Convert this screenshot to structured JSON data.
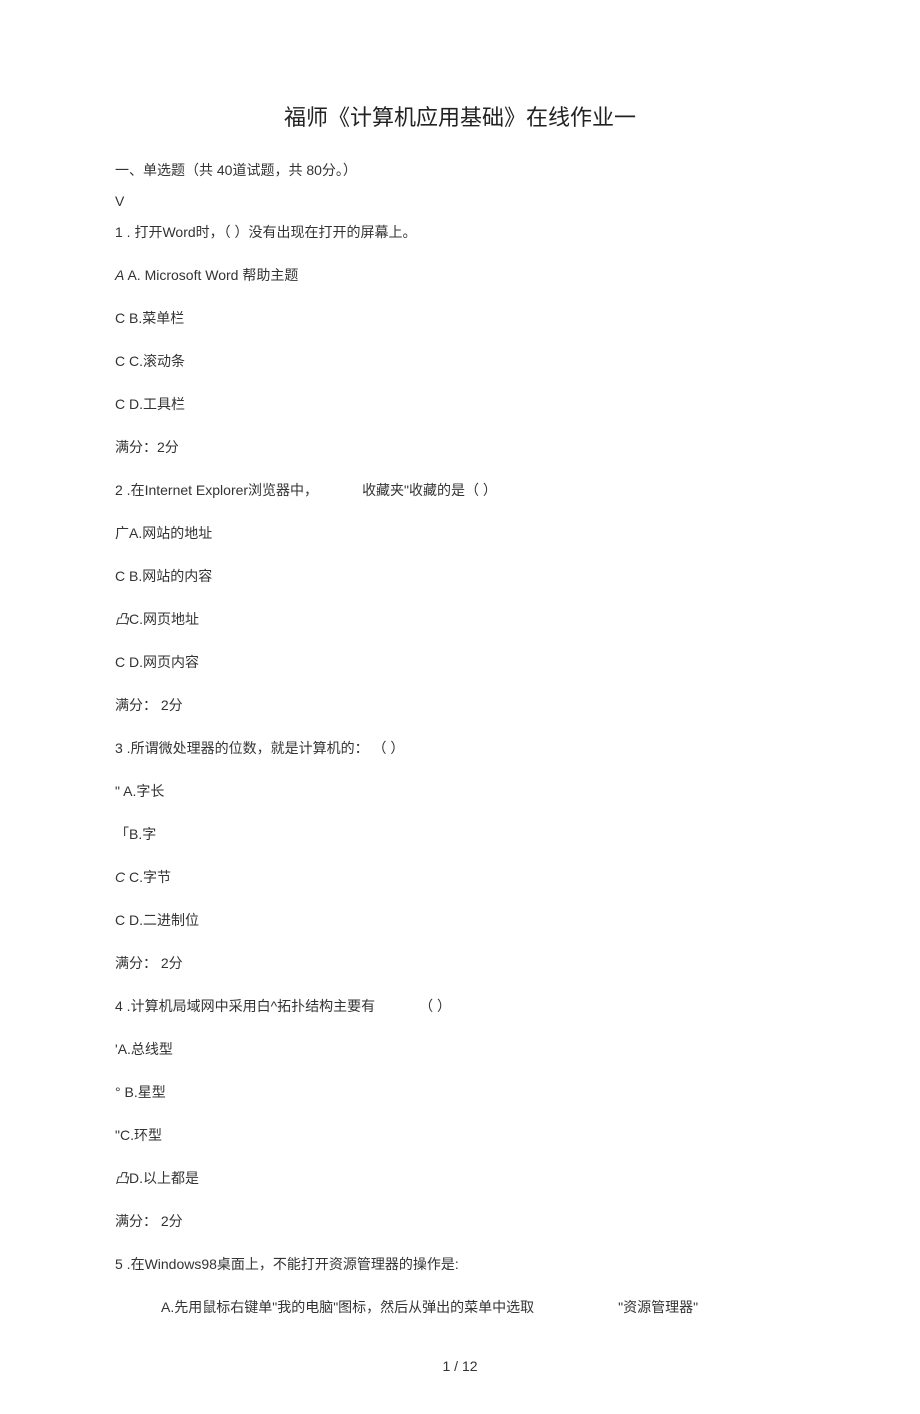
{
  "title": "福师《计算机应用基础》在线作业一",
  "section_header": "一、单选题（共 40道试题，共 80分。）",
  "v": "V",
  "q1": {
    "stem": "1 . 打开Word时，（ ）没有出现在打开的屏幕上。",
    "A_prefix": "A",
    "A": "A. Microsoft Word 帮助主题",
    "B_prefix": "C",
    "B": "B.菜单栏",
    "C_prefix": "C",
    "C": "C.滚动条",
    "D_prefix": "C",
    "D": "D.工具栏",
    "score": "满分：2分"
  },
  "q2": {
    "stem_a": "2  .在Internet Explorer浏览器中，",
    "stem_b": "收藏夹\"收藏的是（ ）",
    "A_prefix": "广",
    "A": "A.网站的地址",
    "B_prefix": "C",
    "B": "B.网站的内容",
    "C_prefix": "凸",
    "C": "C.网页地址",
    "D_prefix": "C",
    "D": "D.网页内容",
    "score": "满分： 2分"
  },
  "q3": {
    "stem": "3  .所谓微处理器的位数，就是计算机的：  （ ）",
    "A_prefix": "\"",
    "A": "A.字长",
    "B_prefix": "「",
    "B": "B.字",
    "C_prefix": "C",
    "C_italic": true,
    "C": "C.字节",
    "D_prefix": "C",
    "D": "D.二进制位",
    "score": "满分： 2分"
  },
  "q4": {
    "stem_a": "4  .计算机局域网中采用白^拓扑结构主要有",
    "stem_b": "（ ）",
    "A_prefix": "'",
    "A": "A.总线型",
    "B_prefix": "°",
    "B": "B.星型",
    "C_prefix": "\"",
    "C": "C.环型",
    "D_prefix": "凸",
    "D": "D.以上都是",
    "score": "满分： 2分"
  },
  "q5": {
    "stem": "5  .在Windows98桌面上，不能打开资源管理器的操作是:",
    "A_a": "A.先用鼠标右键单\"我的电脑\"图标，然后从弹出的菜单中选取",
    "A_b": "\"资源管理器\""
  },
  "pagenum": "1 / 12"
}
